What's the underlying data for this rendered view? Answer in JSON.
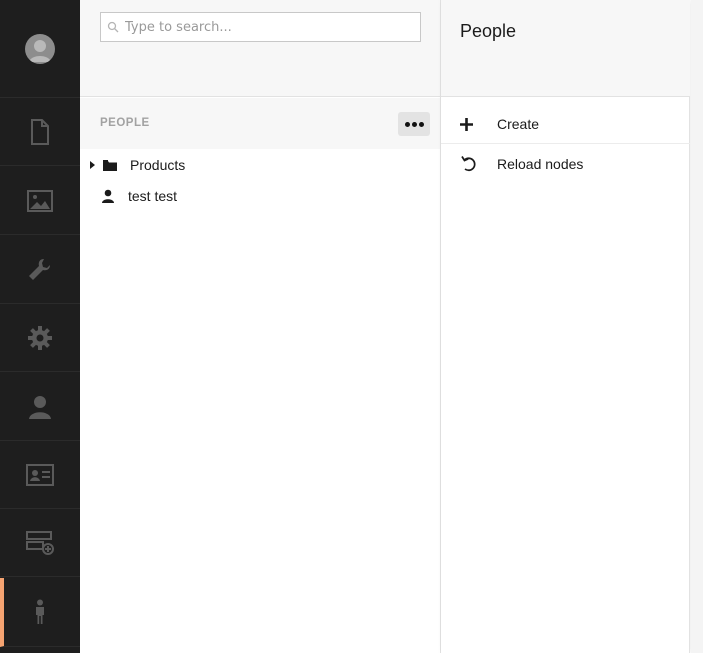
{
  "section_nav": {
    "items": [
      {
        "icon": "document-icon"
      },
      {
        "icon": "image-icon"
      },
      {
        "icon": "wrench-icon"
      },
      {
        "icon": "gear-icon"
      },
      {
        "icon": "user-icon"
      },
      {
        "icon": "id-card-icon"
      },
      {
        "icon": "form-icon"
      },
      {
        "icon": "person-standing-icon",
        "active": true
      }
    ],
    "active_color": "#f5a371"
  },
  "search": {
    "value": "",
    "placeholder": "Type to search..."
  },
  "tree": {
    "section_title": "PEOPLE",
    "options_label": "•••",
    "nodes": [
      {
        "label": "Products",
        "icon": "folder-icon",
        "expandable": true
      },
      {
        "label": "test test",
        "icon": "user-icon",
        "expandable": false
      }
    ]
  },
  "actions": {
    "title": "People",
    "items": [
      {
        "label": "Create",
        "icon": "plus-icon"
      },
      {
        "label": "Reload nodes",
        "icon": "reload-icon"
      }
    ]
  }
}
